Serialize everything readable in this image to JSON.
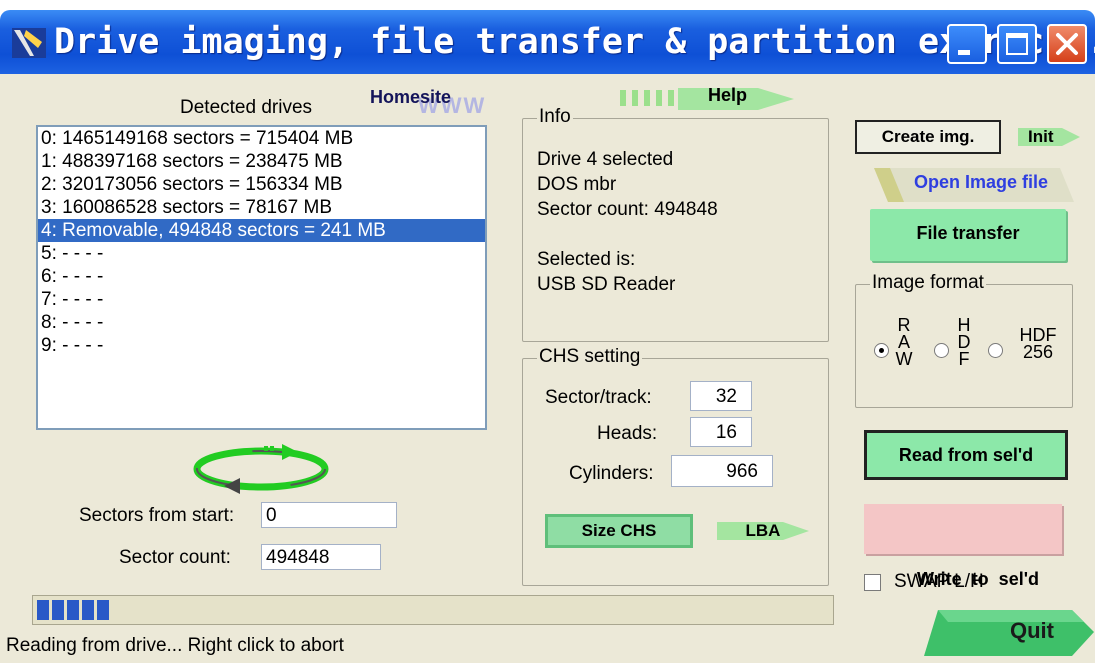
{
  "window": {
    "title": "Drive imaging, file transfer & partition extrac...",
    "icons": {
      "app": "app-icon",
      "minimize": "minimize-icon",
      "maximize": "maximize-icon",
      "close": "close-icon"
    }
  },
  "drives": {
    "label": "Detected drives",
    "items": [
      "0: 1465149168 sectors = 715404 MB",
      "1: 488397168 sectors = 238475 MB",
      "2: 320173056 sectors = 156334 MB",
      "3: 160086528 sectors = 78167 MB",
      "4: Removable, 494848 sectors = 241 MB",
      "5:  - - - -",
      "6:  - - - -",
      "7:  - - - -",
      "8:  - - - -",
      "9:  - - - -"
    ],
    "selected_index": 4
  },
  "links": {
    "homesite": "Homesite",
    "www": "WWW",
    "help": "Help"
  },
  "info": {
    "title": "Info",
    "lines": [
      "Drive 4 selected",
      "DOS mbr",
      "Sector count: 494848",
      "",
      "Selected is:",
      "USB SD Reader"
    ]
  },
  "chs": {
    "title": "CHS setting",
    "sector_track_label": "Sector/track:",
    "sector_track_value": "32",
    "heads_label": "Heads:",
    "heads_value": "16",
    "cylinders_label": "Cylinders:",
    "cylinders_value": "966",
    "size_chs_label": "Size CHS",
    "lba_label": "LBA"
  },
  "fields": {
    "sectors_from_start_label": "Sectors from start:",
    "sectors_from_start_value": "0",
    "sector_count_label": "Sector count:",
    "sector_count_value": "494848"
  },
  "buttons": {
    "create_img": "Create img.",
    "init": "Init",
    "open_image": "Open Image file",
    "file_transfer": "File transfer",
    "read_from_sel": "Read from sel'd",
    "write_to_sel": "Write  to  sel'd",
    "quit": "Quit"
  },
  "image_format": {
    "title": "Image format",
    "options": [
      {
        "lines": [
          "R",
          "A",
          "W"
        ],
        "checked": true
      },
      {
        "lines": [
          "H",
          "D",
          "F"
        ],
        "checked": false
      },
      {
        "lines": [
          "HDF",
          "256"
        ],
        "checked": false
      }
    ]
  },
  "swap": {
    "label": "SWAP L/H",
    "checked": false
  },
  "progress": {
    "fraction": 0.09
  },
  "status": "Reading from drive... Right click to abort",
  "colors": {
    "titlebar": "#0e50d6",
    "face": "#ece9d8",
    "selection": "#316ac5",
    "green_button": "#8ce8a9",
    "pink_button": "#f4c6c6",
    "progress": "#2a59c7"
  }
}
